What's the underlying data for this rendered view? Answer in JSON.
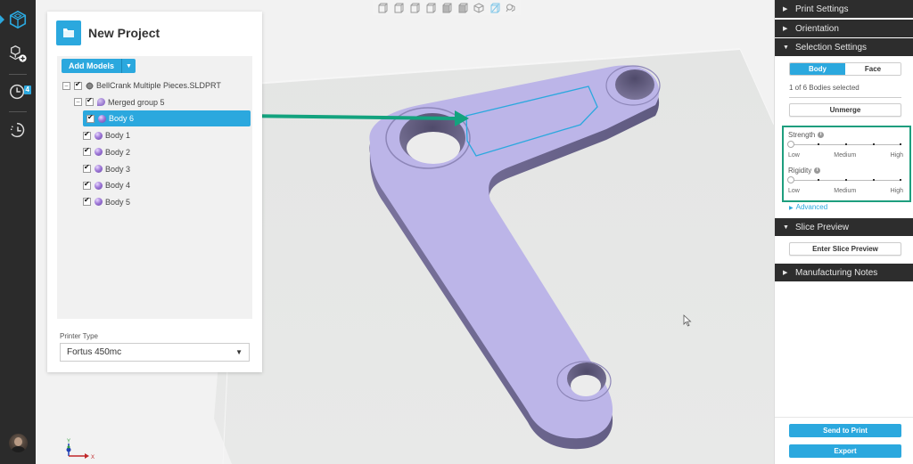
{
  "rail": {
    "items": [
      {
        "name": "project-cube-icon",
        "active": true
      },
      {
        "name": "add-model-icon"
      },
      {
        "name": "print-queue-icon",
        "badge": "4"
      },
      {
        "name": "history-icon"
      }
    ]
  },
  "viewport": {
    "view_toolbar": [
      {
        "name": "view-front-icon"
      },
      {
        "name": "view-back-icon"
      },
      {
        "name": "view-left-icon"
      },
      {
        "name": "view-right-icon"
      },
      {
        "name": "view-top-icon"
      },
      {
        "name": "view-bottom-icon"
      },
      {
        "name": "view-iso-icon"
      },
      {
        "name": "view-transparent-icon",
        "active": true
      },
      {
        "name": "view-zoom-fit-icon"
      }
    ],
    "axes": {
      "x_label": "X",
      "y_label": "Y"
    },
    "colors": {
      "model": "#b9b3e6",
      "selection_outline": "#2ba8de",
      "annotation_arrow": "#13a37e"
    }
  },
  "project": {
    "title": "New Project",
    "add_models_label": "Add Models",
    "tree": [
      {
        "label": "BellCrank Multiple Pieces.SLDPRT",
        "level": 0,
        "expandable": true,
        "checked": true,
        "icon": "part-icon"
      },
      {
        "label": "Merged group 5",
        "level": 1,
        "expandable": true,
        "checked": true,
        "icon": "group-icon"
      },
      {
        "label": "Body 6",
        "level": 2,
        "checked": true,
        "selected": true,
        "icon": "body-icon"
      },
      {
        "label": "Body 1",
        "level": 2,
        "checked": true,
        "icon": "body-icon"
      },
      {
        "label": "Body 2",
        "level": 2,
        "checked": true,
        "icon": "body-icon"
      },
      {
        "label": "Body 3",
        "level": 2,
        "checked": true,
        "icon": "body-icon"
      },
      {
        "label": "Body 4",
        "level": 2,
        "checked": true,
        "icon": "body-icon"
      },
      {
        "label": "Body 5",
        "level": 2,
        "checked": true,
        "icon": "body-icon"
      }
    ],
    "printer_type_label": "Printer Type",
    "printer_type_value": "Fortus 450mc"
  },
  "right_panel": {
    "sections": {
      "print_settings": "Print Settings",
      "orientation": "Orientation",
      "selection_settings": "Selection Settings",
      "slice_preview": "Slice Preview",
      "manufacturing_notes": "Manufacturing Notes"
    },
    "selection": {
      "mode_body": "Body",
      "mode_face": "Face",
      "active_mode": "Body",
      "bodies_selected": "1 of 6 Bodies selected",
      "unmerge_label": "Unmerge",
      "strength_label": "Strength",
      "rigidity_label": "Rigidity",
      "tick_low": "Low",
      "tick_medium": "Medium",
      "tick_high": "High",
      "strength_value": "Low",
      "rigidity_value": "Low",
      "advanced_label": "Advanced"
    },
    "slice_preview_button": "Enter Slice Preview",
    "send_to_print": "Send to Print",
    "export": "Export",
    "accent": "#2ba8de",
    "highlight_box": "#1e9e7e"
  }
}
